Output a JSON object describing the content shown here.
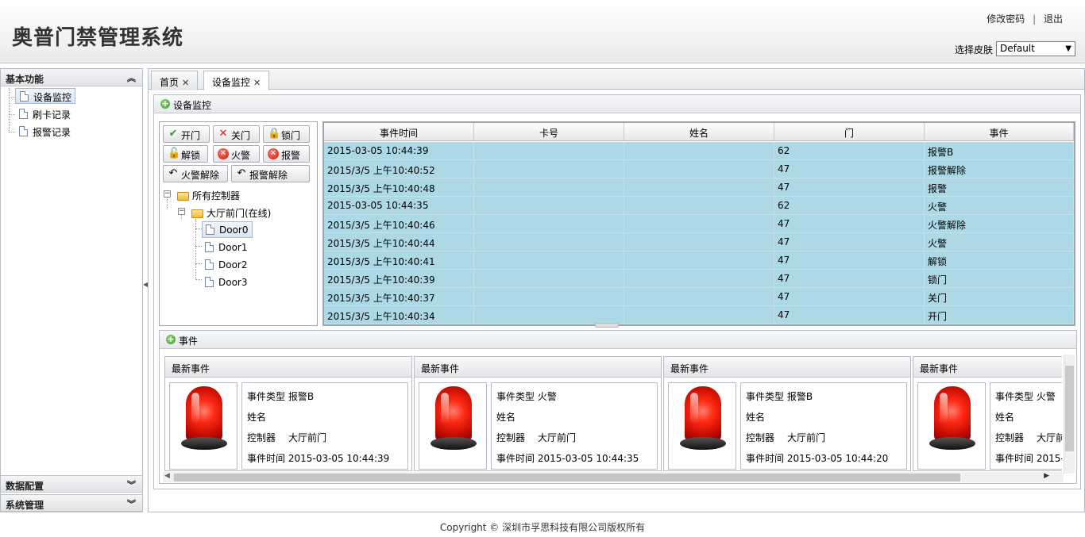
{
  "app": {
    "title": "奥普门禁管理系统"
  },
  "top_links": {
    "change_password": "修改密码",
    "separator": "|",
    "logout": "退出"
  },
  "skin": {
    "label": "选择皮肤",
    "selected": "Default"
  },
  "sidebar": {
    "sections": [
      {
        "title": "基本功能",
        "expanded": true,
        "items": [
          "设备监控",
          "刷卡记录",
          "报警记录"
        ],
        "selected": "设备监控"
      },
      {
        "title": "数据配置",
        "expanded": false
      },
      {
        "title": "系统管理",
        "expanded": false
      }
    ]
  },
  "tabs": [
    {
      "label": "首页",
      "active": false
    },
    {
      "label": "设备监控",
      "active": true
    }
  ],
  "panel": {
    "title": "设备监控"
  },
  "controls": {
    "buttons": [
      "开门",
      "关门",
      "锁门",
      "解锁",
      "火警",
      "报警",
      "火警解除",
      "报警解除"
    ]
  },
  "tree": {
    "root": "所有控制器",
    "controller": "大厅前门(在线)",
    "doors": [
      "Door0",
      "Door1",
      "Door2",
      "Door3"
    ],
    "selected": "Door0"
  },
  "grid": {
    "columns": [
      "事件时间",
      "卡号",
      "姓名",
      "门",
      "事件"
    ],
    "rows": [
      {
        "time": "2015-03-05 10:44:39",
        "card": "",
        "name": "",
        "door": "62",
        "event": "报警B"
      },
      {
        "time": "2015/3/5 上午10:40:52",
        "card": "",
        "name": "",
        "door": "47",
        "event": "报警解除"
      },
      {
        "time": "2015/3/5 上午10:40:48",
        "card": "",
        "name": "",
        "door": "47",
        "event": "报警"
      },
      {
        "time": "2015-03-05 10:44:35",
        "card": "",
        "name": "",
        "door": "62",
        "event": "火警"
      },
      {
        "time": "2015/3/5 上午10:40:46",
        "card": "",
        "name": "",
        "door": "47",
        "event": "火警解除"
      },
      {
        "time": "2015/3/5 上午10:40:44",
        "card": "",
        "name": "",
        "door": "47",
        "event": "火警"
      },
      {
        "time": "2015/3/5 上午10:40:41",
        "card": "",
        "name": "",
        "door": "47",
        "event": "解锁"
      },
      {
        "time": "2015/3/5 上午10:40:39",
        "card": "",
        "name": "",
        "door": "47",
        "event": "锁门"
      },
      {
        "time": "2015/3/5 上午10:40:37",
        "card": "",
        "name": "",
        "door": "47",
        "event": "关门"
      },
      {
        "time": "2015/3/5 上午10:40:34",
        "card": "",
        "name": "",
        "door": "47",
        "event": "开门"
      }
    ],
    "row_color": "#add8e6"
  },
  "events": {
    "title": "事件",
    "cards": [
      {
        "header": "最新事件",
        "type_label": "事件类型",
        "type": "报警B",
        "name_label": "姓名",
        "controller_label": "控制器",
        "controller": "大厅前门",
        "time_label": "事件时间",
        "time": "2015-03-05 10:44:39"
      },
      {
        "header": "最新事件",
        "type_label": "事件类型",
        "type": "火警",
        "name_label": "姓名",
        "controller_label": "控制器",
        "controller": "大厅前门",
        "time_label": "事件时间",
        "time": "2015-03-05 10:44:35"
      },
      {
        "header": "最新事件",
        "type_label": "事件类型",
        "type": "报警B",
        "name_label": "姓名",
        "controller_label": "控制器",
        "controller": "大厅前门",
        "time_label": "事件时间",
        "time": "2015-03-05 10:44:20"
      },
      {
        "header": "最新事件",
        "type_label": "事件类型",
        "type": "火警",
        "name_label": "姓名",
        "controller_label": "控制器",
        "controller": "大厅前",
        "time_label": "事件时间",
        "time": "2015-"
      }
    ]
  },
  "footer": {
    "copyright": "Copyright © 深圳市孚思科技有限公司版权所有"
  }
}
